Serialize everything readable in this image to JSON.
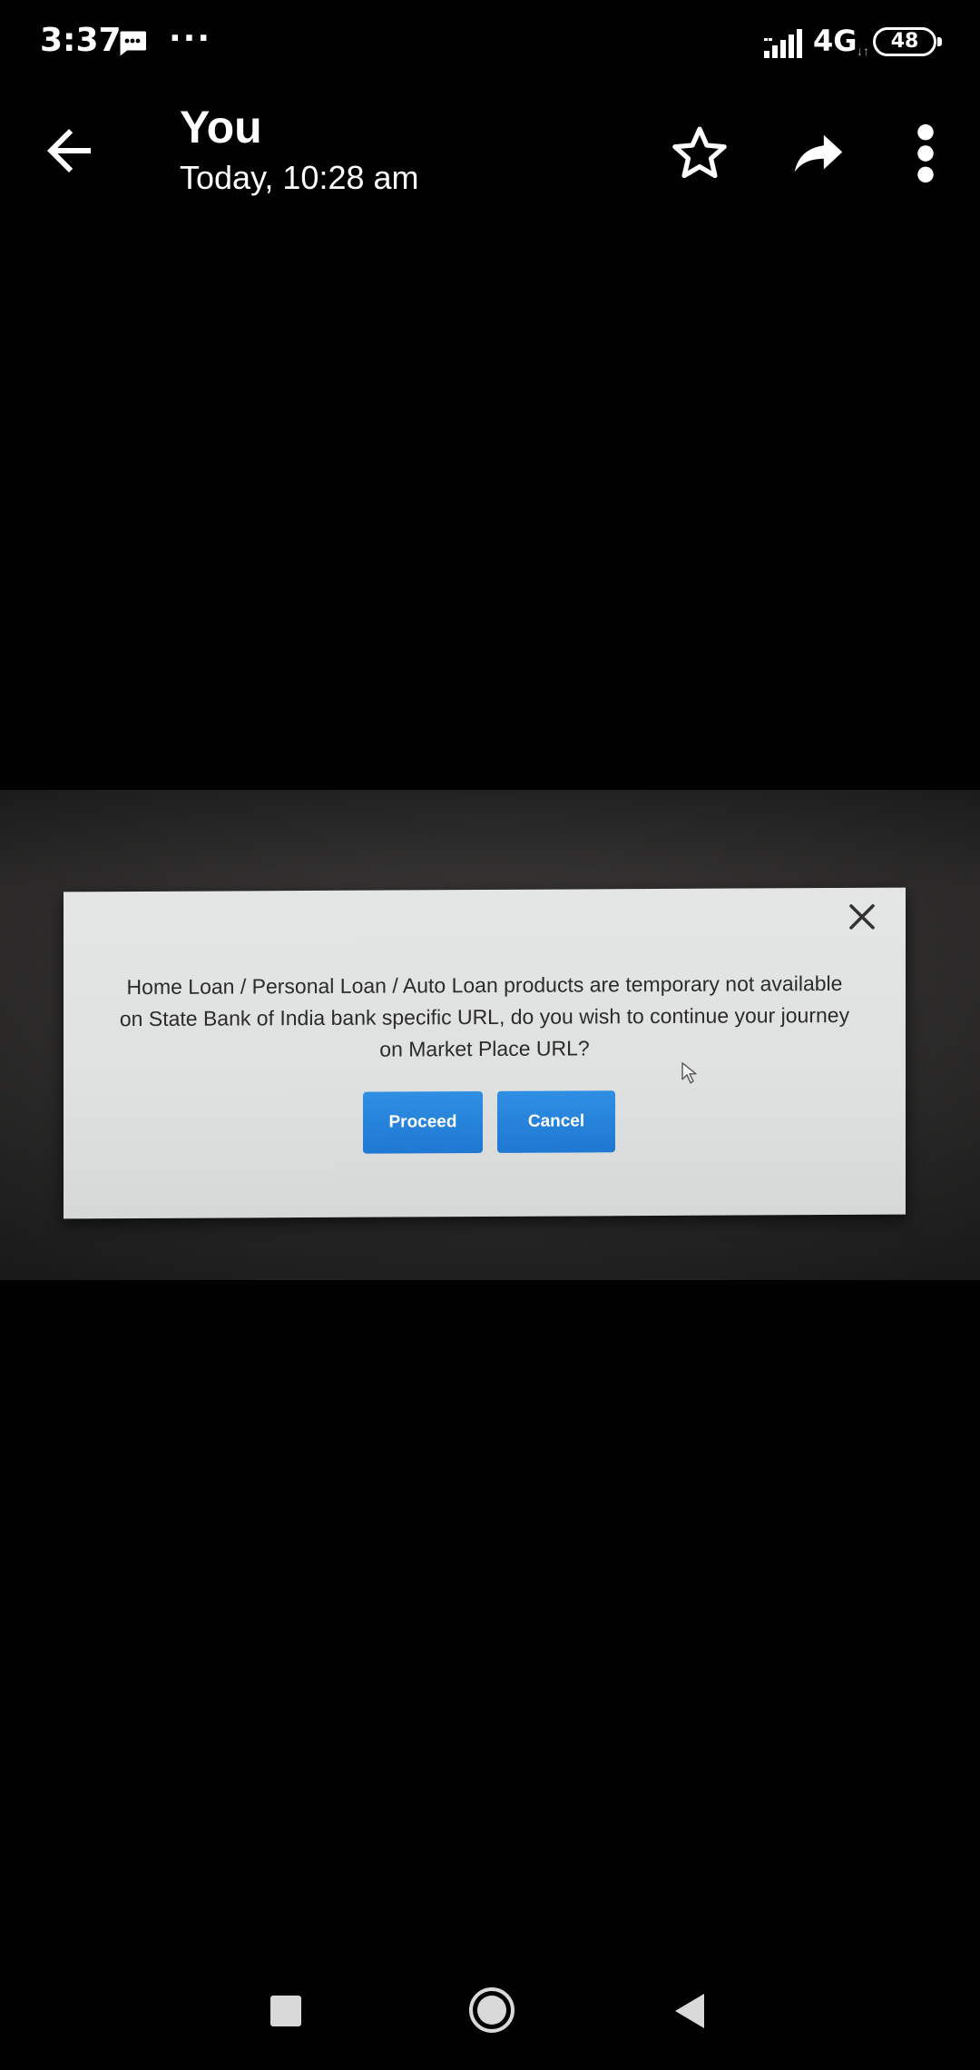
{
  "status_bar": {
    "time": "3:37",
    "more_indicator": "···",
    "network": "4G",
    "network_arrows": "↓↑",
    "battery": "48",
    "icons": [
      "message-icon",
      "signal-icon",
      "battery-icon"
    ]
  },
  "app_bar": {
    "title": "You",
    "subtitle": "Today, 10:28 am",
    "icons": [
      "back-arrow-icon",
      "star-icon",
      "share-icon",
      "overflow-menu-icon"
    ]
  },
  "photo": {
    "dialog": {
      "message": "Home Loan / Personal Loan / Auto Loan products are temporary not available on State Bank of India bank specific URL, do you wish to continue your journey on Market Place URL?",
      "proceed_label": "Proceed",
      "cancel_label": "Cancel",
      "button_color": "#1f78d2",
      "icons": [
        "close-icon",
        "mouse-cursor-icon"
      ]
    }
  },
  "nav_bar": {
    "icons": [
      "recents-icon",
      "home-icon",
      "back-icon"
    ]
  }
}
